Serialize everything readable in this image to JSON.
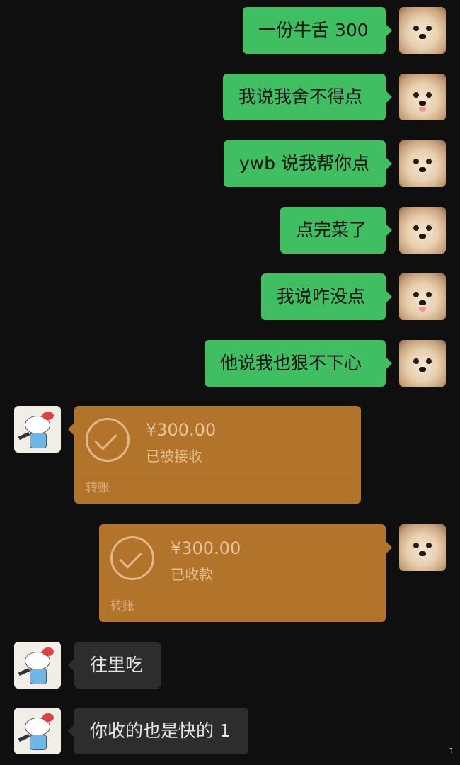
{
  "messages": [
    {
      "side": "right",
      "text": "一份牛舌 300"
    },
    {
      "side": "right",
      "text": "我说我舍不得点"
    },
    {
      "side": "right",
      "text": "ywb 说我帮你点"
    },
    {
      "side": "right",
      "text": "点完菜了"
    },
    {
      "side": "right",
      "text": "我说咋没点"
    },
    {
      "side": "right",
      "text": "他说我也狠不下心"
    },
    {
      "side": "left",
      "type": "transfer",
      "amount": "¥300.00",
      "status": "已被接收",
      "label": "转账"
    },
    {
      "side": "right",
      "type": "transfer",
      "amount": "¥300.00",
      "status": "已收款",
      "label": "转账"
    },
    {
      "side": "left",
      "text": "往里吃"
    },
    {
      "side": "left",
      "text": "你收的也是快的 1"
    }
  ],
  "corner_number": "1",
  "colors": {
    "green_bubble": "#3fbf61",
    "transfer_orange": "#b2732a",
    "gray_bubble": "#2d2d2d",
    "background": "#0f0f0f"
  }
}
